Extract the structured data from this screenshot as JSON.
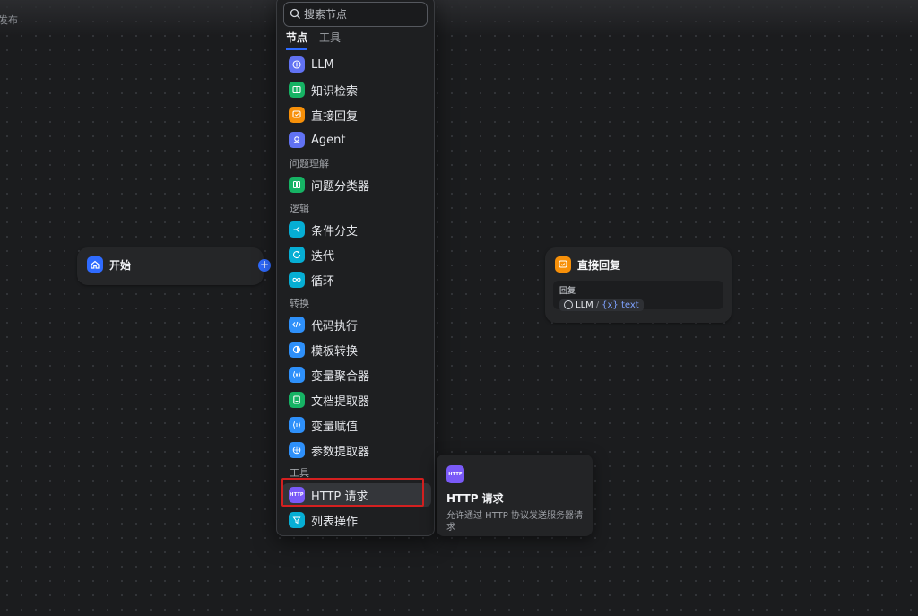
{
  "canvas": {
    "corner_label": "发布"
  },
  "start_node": {
    "title": "开始",
    "icon": "home-icon",
    "color": "#2f6bff"
  },
  "reply_node": {
    "title": "直接回复",
    "icon": "message-icon",
    "color": "#f79009",
    "field_label": "回复",
    "var_source": "LLM",
    "var_sep": "/",
    "var_name": "{x} text"
  },
  "picker": {
    "search_placeholder": "搜索节点",
    "tabs": [
      "节点",
      "工具"
    ],
    "items": {
      "llm": "LLM",
      "knowledge": "知识检索",
      "answer": "直接回复",
      "agent": "Agent",
      "classifier": "问题分类器",
      "ifelse": "条件分支",
      "iteration": "迭代",
      "loop": "循环",
      "code": "代码执行",
      "template": "模板转换",
      "aggregator": "变量聚合器",
      "doc_extractor": "文档提取器",
      "assigner": "变量赋值",
      "param_extractor": "参数提取器",
      "http": "HTTP 请求",
      "list_op": "列表操作"
    },
    "groups": {
      "understanding": "问题理解",
      "logic": "逻辑",
      "transform": "转换",
      "tools": "工具"
    },
    "colors": {
      "indigo": "#6172f3",
      "green": "#16b364",
      "orange": "#f79009",
      "teal": "#06aed4",
      "blue": "#2e90fa",
      "purple": "#7a5af8"
    }
  },
  "tooltip": {
    "badge": "HTTP",
    "title": "HTTP 请求",
    "desc": "允许通过 HTTP 协议发送服务器请求"
  }
}
